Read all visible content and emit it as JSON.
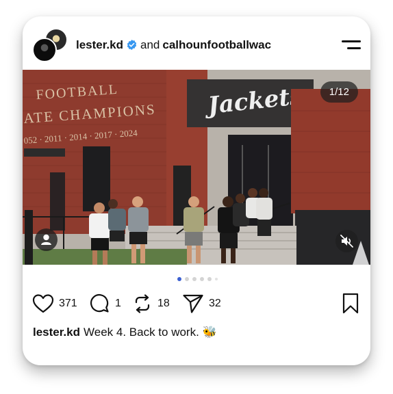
{
  "post": {
    "author": "lester.kd",
    "conjunction": "and",
    "collaborator": "calhounfootballwac",
    "verified": true
  },
  "icons": {
    "verified": "verified-badge-icon",
    "menu": "menu-icon",
    "like": "heart-icon",
    "comment": "comment-icon",
    "repost": "repost-icon",
    "share": "send-icon",
    "save": "bookmark-icon",
    "tag": "person-tag-icon",
    "mute": "speaker-muted-icon"
  },
  "media": {
    "counter": "1/12",
    "scene_text": {
      "wall_line1": "FOOTBALL",
      "wall_line2": "ATE CHAMPIONS",
      "wall_years": "052 · 2011 · 2014 · 2017 · 2024",
      "sign": "Jackets"
    }
  },
  "carousel": {
    "total_dots": 6,
    "active_index": 0
  },
  "actions": {
    "likes": "371",
    "comments": "1",
    "reposts": "18",
    "shares": "32"
  },
  "caption": {
    "user": "lester.kd",
    "text": "Week 4. Back to work. 🐝"
  },
  "colors": {
    "accent_blue": "#3797f0",
    "text": "#111111",
    "active_dot": "#3b5fd1",
    "brick": "#8b3a2c"
  }
}
